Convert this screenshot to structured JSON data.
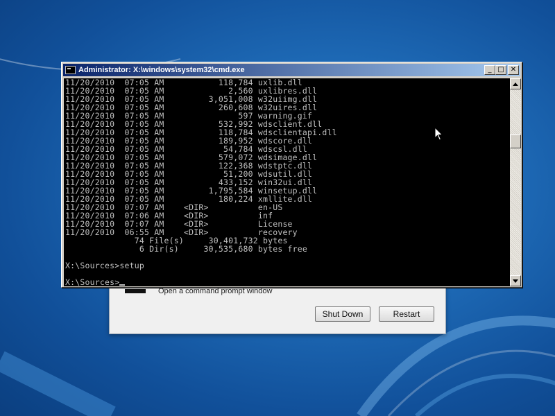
{
  "window": {
    "title": "Administrator: X:\\windows\\system32\\cmd.exe",
    "minimize_glyph": "_",
    "maximize_glyph": "□",
    "close_glyph": "✕"
  },
  "console": {
    "lines": [
      "11/20/2010  07:05 AM           118,784 uxlib.dll",
      "11/20/2010  07:05 AM             2,560 uxlibres.dll",
      "11/20/2010  07:05 AM         3,051,008 w32uiimg.dll",
      "11/20/2010  07:05 AM           260,608 w32uires.dll",
      "11/20/2010  07:05 AM               597 warning.gif",
      "11/20/2010  07:05 AM           532,992 wdsclient.dll",
      "11/20/2010  07:05 AM           118,784 wdsclientapi.dll",
      "11/20/2010  07:05 AM           189,952 wdscore.dll",
      "11/20/2010  07:05 AM            54,784 wdscsl.dll",
      "11/20/2010  07:05 AM           579,072 wdsimage.dll",
      "11/20/2010  07:05 AM           122,368 wdstptc.dll",
      "11/20/2010  07:05 AM            51,200 wdsutil.dll",
      "11/20/2010  07:05 AM           433,152 win32ui.dll",
      "11/20/2010  07:05 AM         1,795,584 winsetup.dll",
      "11/20/2010  07:05 AM           180,224 xmllite.dll",
      "11/20/2010  07:07 AM    <DIR>          en-US",
      "11/20/2010  07:06 AM    <DIR>          inf",
      "11/20/2010  07:07 AM    <DIR>          License",
      "11/20/2010  06:55 AM    <DIR>          recovery",
      "              74 File(s)     30,401,732 bytes",
      "               6 Dir(s)     30,535,680 bytes free",
      "",
      "X:\\Sources>setup",
      ""
    ],
    "prompt": "X:\\Sources>"
  },
  "dialog": {
    "description": "Open a command prompt window",
    "shutdown_label": "Shut Down",
    "restart_label": "Restart"
  },
  "icons": {
    "window": "cmd-icon",
    "pointer": "mouse-pointer-icon",
    "scroll_up": "scroll-up-arrow-icon",
    "scroll_down": "scroll-down-arrow-icon"
  },
  "colors": {
    "console_bg": "#000000",
    "console_fg": "#c0c0c0",
    "title_bar_start": "#0a246a",
    "title_bar_end": "#a6caf0",
    "desktop": "#1f6cb8"
  }
}
